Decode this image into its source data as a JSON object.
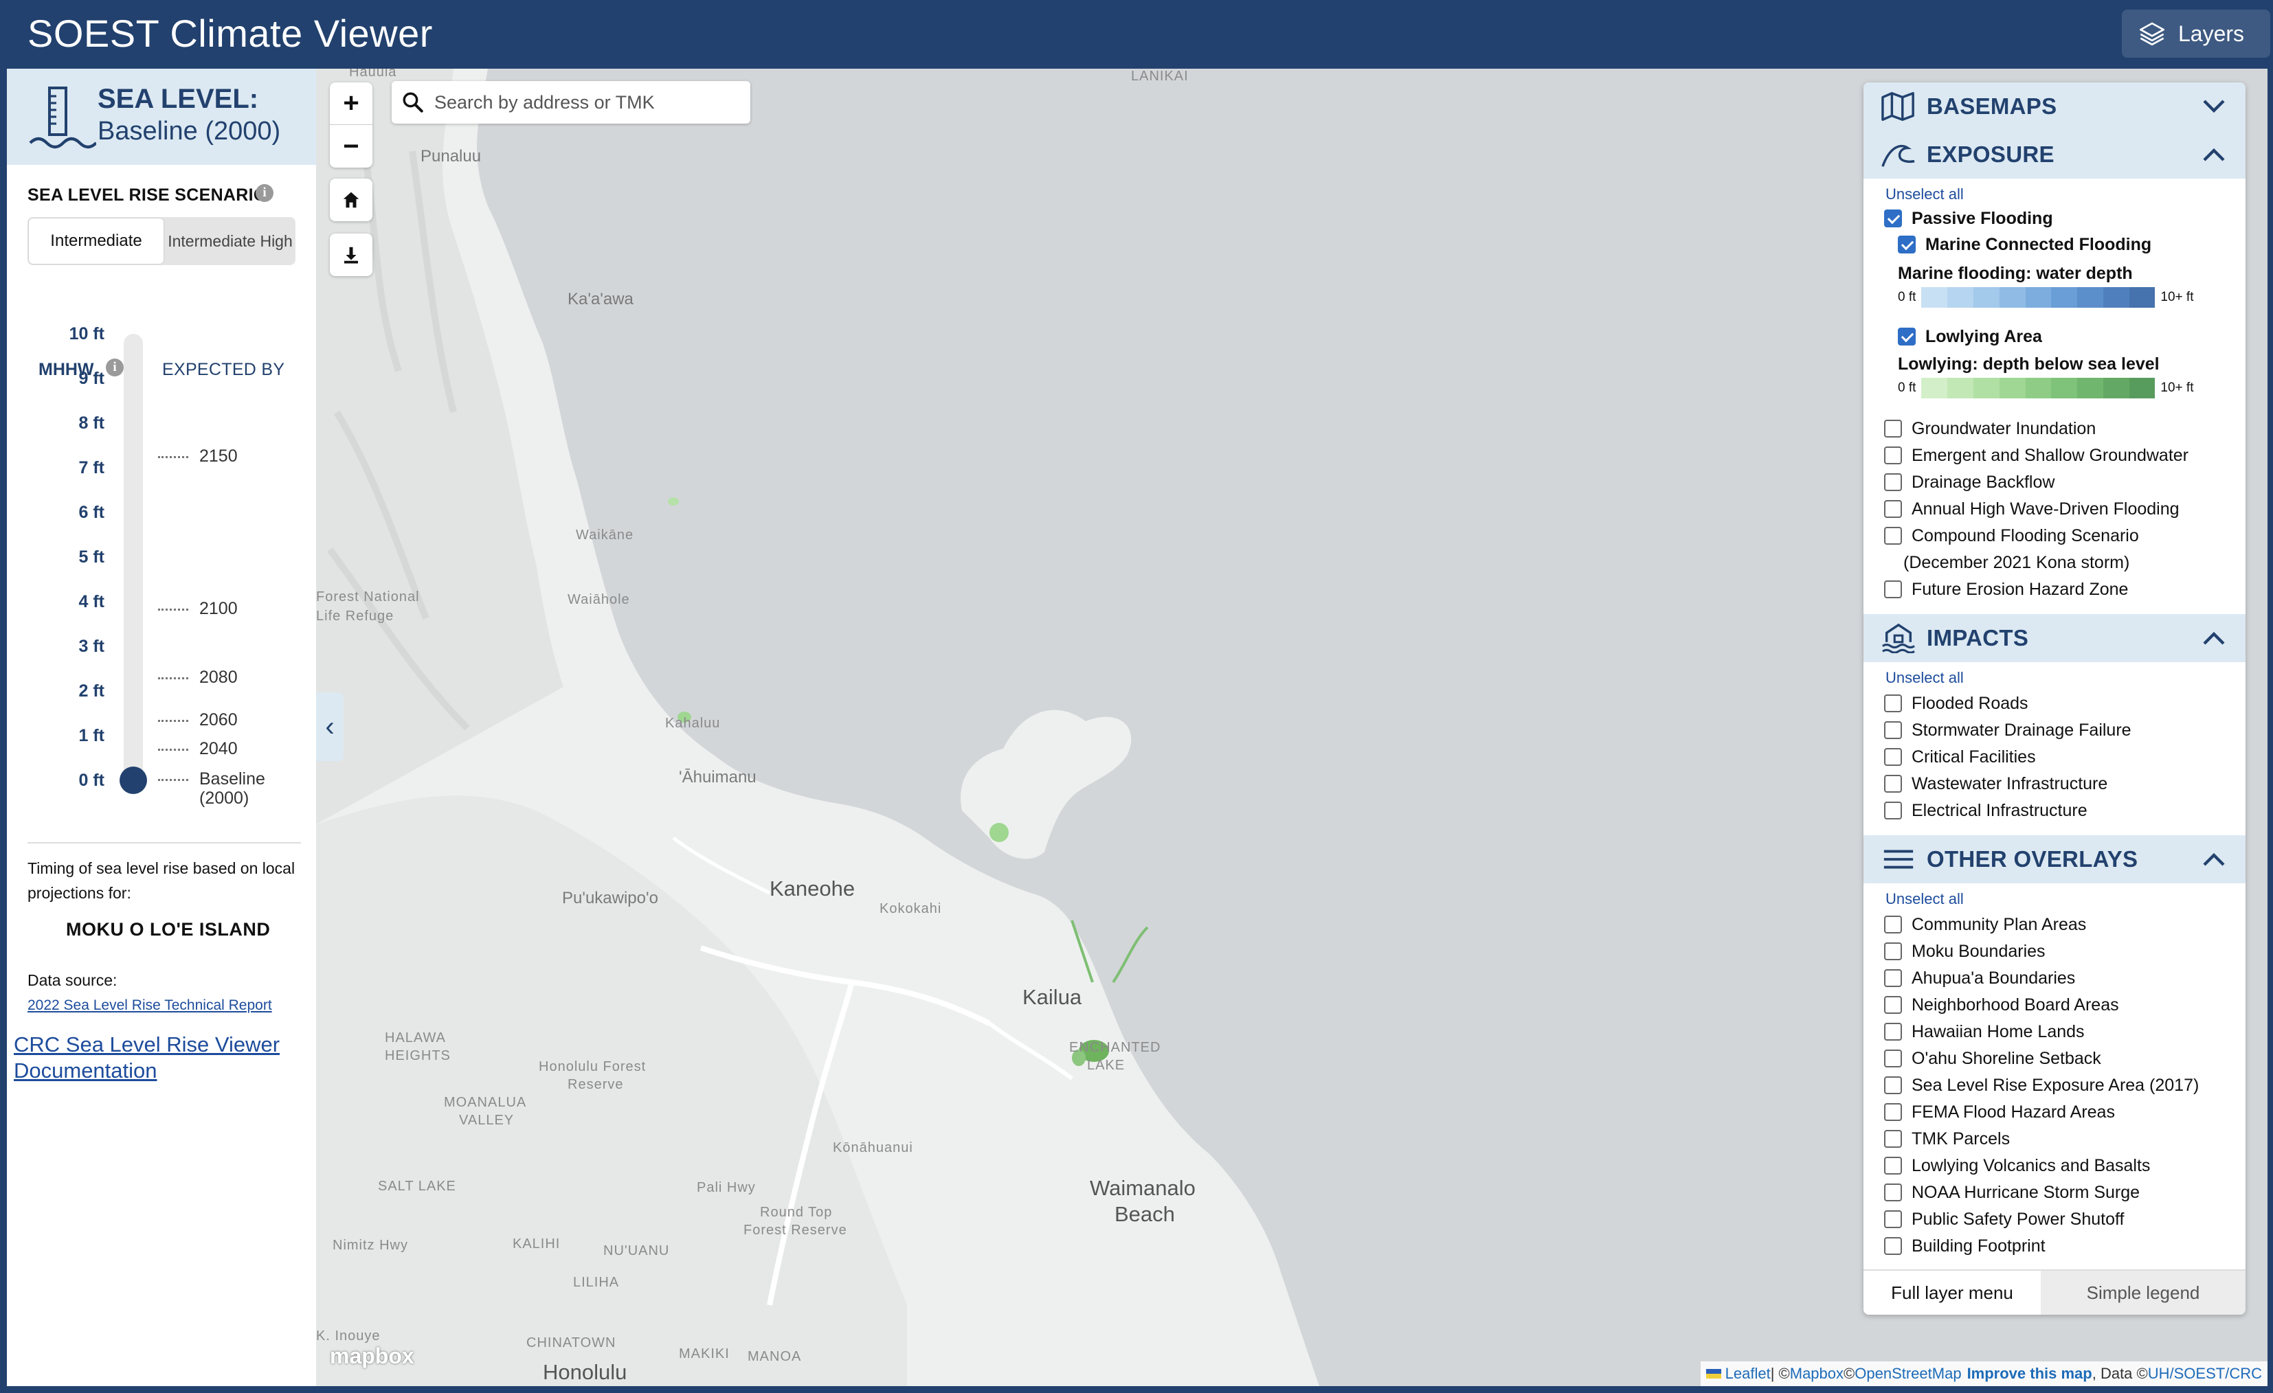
{
  "app": {
    "title": "SOEST Climate Viewer",
    "layers_button": "Layers"
  },
  "sidebar": {
    "title": "SEA LEVEL:",
    "subtitle": "Baseline (2000)",
    "scenario_label": "SEA LEVEL RISE SCENARIO",
    "scenario_options": [
      "Intermediate",
      "Intermediate High"
    ],
    "scenario_selected": "Intermediate",
    "mhhw_label": "MHHW",
    "expected_label": "EXPECTED BY",
    "feet": [
      "10 ft",
      "9 ft",
      "8 ft",
      "7 ft",
      "6 ft",
      "5 ft",
      "4 ft",
      "3 ft",
      "2 ft",
      "1 ft",
      "0 ft"
    ],
    "years": [
      {
        "label": "2150"
      },
      {
        "label": "2100"
      },
      {
        "label": "2080"
      },
      {
        "label": "2060"
      },
      {
        "label": "2040"
      },
      {
        "label": "Baseline (2000)"
      }
    ],
    "slider_value_ft": 0,
    "timing_text": "Timing of sea level rise based on local projections for:",
    "island": "MOKU O LO'E ISLAND",
    "source_label": "Data source:",
    "source_link": "2022 Sea Level Rise Technical Report",
    "crc_link": "CRC Sea Level Rise Viewer Documentation"
  },
  "map": {
    "search_placeholder": "Search by address or TMK",
    "zoom_in": "+",
    "zoom_out": "−",
    "places": [
      "Hauula",
      "Punaluu",
      "Ka'a'awa",
      "Waikāne",
      "Waiāhole",
      "Forest National",
      "Life Refuge",
      "Kahaluu",
      "'Āhuimanu",
      "Kaneohe",
      "Pu'ukawipo'o",
      "Kokokahi",
      "Kailua",
      "LANIKAI",
      "ENCHANTED",
      "LAKE",
      "HALAWA",
      "HEIGHTS",
      "Honolulu Forest",
      "Reserve",
      "MOANALUA",
      "VALLEY",
      "Kōnāhuanui",
      "Waimanalo",
      "Beach",
      "SALT LAKE",
      "Nimitz Hwy",
      "KALIHI",
      "NU'UANU",
      "Pali Hwy",
      "Round Top",
      "Forest Reserve",
      "LILIHA",
      "CHINATOWN",
      "MAKIKI",
      "MANOA",
      "Honolulu",
      "K. Inouye"
    ],
    "mapbox_logo": "mapbox",
    "attribution": {
      "leaflet": "Leaflet",
      "sep": " | © ",
      "mapbox": "Mapbox",
      "c1": " © ",
      "osm": "OpenStreetMap",
      "improve": "Improve this map",
      "data": ", Data © ",
      "uh": "UH/SOEST/CRC"
    }
  },
  "panel": {
    "sections": {
      "basemaps": "BASEMAPS",
      "exposure": "EXPOSURE",
      "impacts": "IMPACTS",
      "other": "OTHER OVERLAYS"
    },
    "unselect_all": "Unselect all",
    "exposure": {
      "passive": "Passive Flooding",
      "marine": "Marine Connected Flooding",
      "marine_legend": "Marine flooding: water depth",
      "lowlying": "Lowlying Area",
      "lowlying_legend": "Lowlying: depth below sea level",
      "legend_min": "0 ft",
      "legend_max": "10+ ft",
      "items": [
        "Groundwater Inundation",
        "Emergent and Shallow Groundwater",
        "Drainage Backflow",
        "Annual High Wave-Driven Flooding",
        "Compound Flooding Scenario",
        "(December 2021 Kona storm)",
        "Future Erosion Hazard Zone"
      ]
    },
    "impacts": [
      "Flooded Roads",
      "Stormwater Drainage Failure",
      "Critical Facilities",
      "Wastewater Infrastructure",
      "Electrical Infrastructure"
    ],
    "other": [
      "Community Plan Areas",
      "Moku Boundaries",
      "Ahupua'a Boundaries",
      "Neighborhood Board Areas",
      "Hawaiian Home Lands",
      "O'ahu Shoreline Setback",
      "Sea Level Rise Exposure Area (2017)",
      "FEMA Flood Hazard Areas",
      "TMK Parcels",
      "Lowlying Volcanics and Basalts",
      "NOAA Hurricane Storm Surge",
      "Public Safety Power Shutoff",
      "Building Footprint"
    ],
    "tabs": {
      "full": "Full layer menu",
      "simple": "Simple legend"
    },
    "colors": {
      "marine_ramp": [
        "#c8e0f4",
        "#b6d5f0",
        "#a3c9eb",
        "#8fbbe5",
        "#7cadde",
        "#6a9ed6",
        "#5b8fcb",
        "#4f80bd",
        "#4672ad"
      ],
      "lowlying_ramp": [
        "#d3efc9",
        "#c2e8b6",
        "#b1e0a4",
        "#a0d794",
        "#8fcd86",
        "#7fc27a",
        "#70b66f",
        "#63a965",
        "#589c5d"
      ]
    }
  }
}
